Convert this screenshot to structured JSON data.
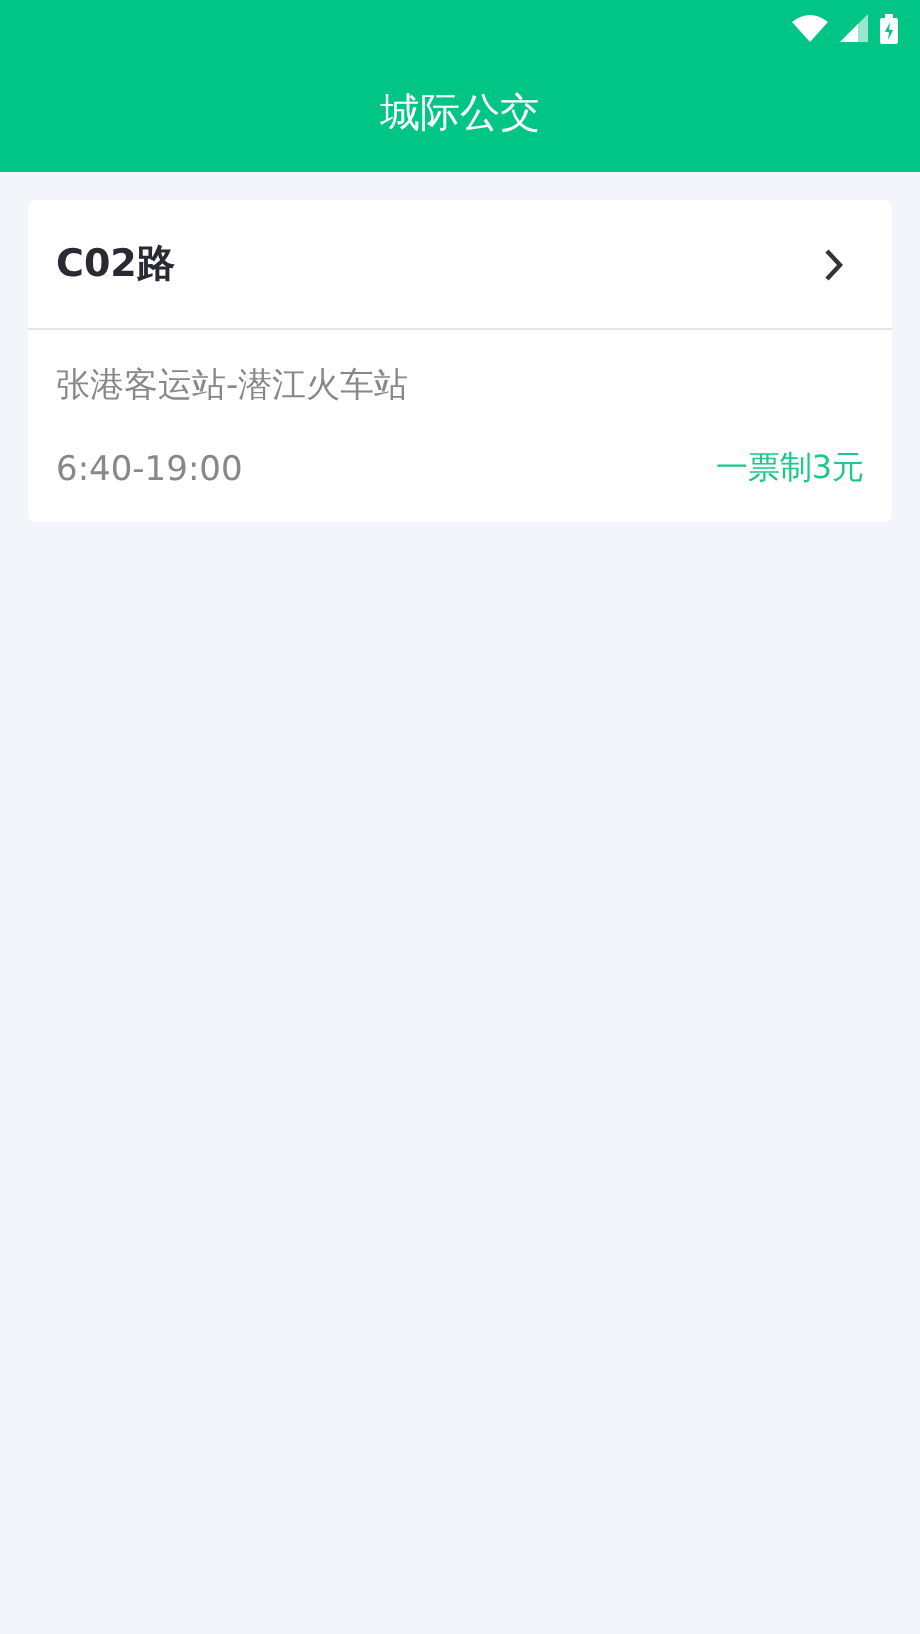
{
  "header": {
    "title": "城际公交"
  },
  "routes": [
    {
      "name": "C02路",
      "stops": "张港客运站-潜江火车站",
      "hours": "6:40-19:00",
      "fare": "一票制3元"
    }
  ]
}
